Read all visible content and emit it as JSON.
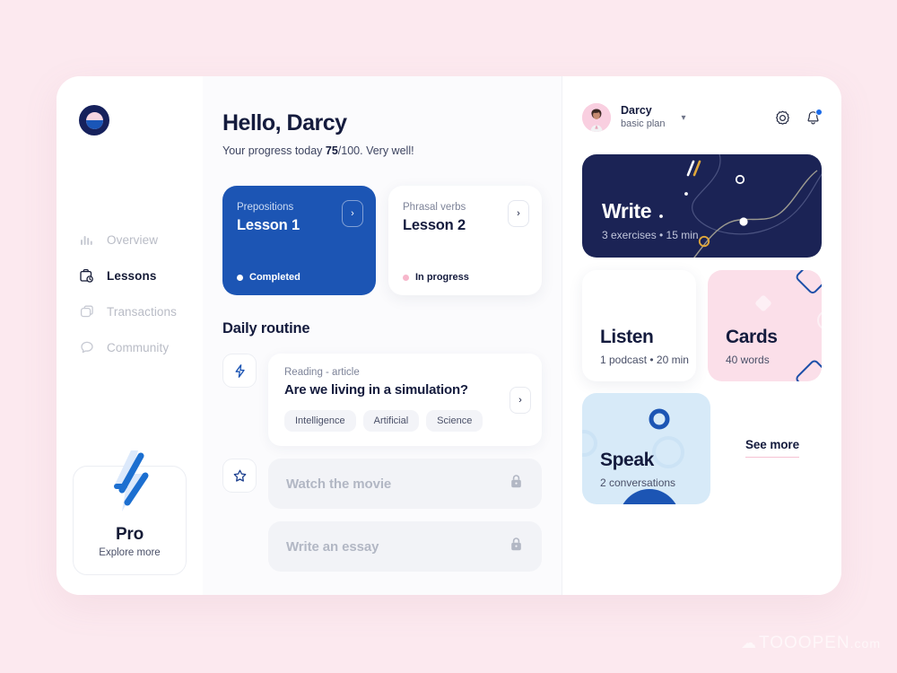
{
  "watermark": {
    "text": "TOOOPEN",
    "suffix": ".com"
  },
  "brand": {
    "logo_name": "app-logo",
    "accent_blue": "#1c55b4",
    "navy": "#141b3d",
    "pink": "#fbdfe9",
    "bg": "#fce9ef"
  },
  "sidebar": {
    "items": [
      {
        "label": "Overview",
        "icon": "bar-chart-icon",
        "active": false
      },
      {
        "label": "Lessons",
        "icon": "lesson-bag-clock-icon",
        "active": true
      },
      {
        "label": "Transactions",
        "icon": "card-stack-icon",
        "active": false
      },
      {
        "label": "Community",
        "icon": "speech-bubble-icon",
        "active": false
      }
    ],
    "pro": {
      "title": "Pro",
      "subtitle": "Explore more",
      "icon": "lightning-bolt-icon"
    }
  },
  "greeting": {
    "title": "Hello, Darcy",
    "progress_prefix": "Your progress today ",
    "progress_value": "75",
    "progress_suffix": "/100. Very well!"
  },
  "lessons": [
    {
      "category": "Prepositions",
      "title": "Lesson 1",
      "status": "Completed",
      "state": "completed"
    },
    {
      "category": "Phrasal verbs",
      "title": "Lesson 2",
      "status": "In progress",
      "state": "in-progress"
    }
  ],
  "daily_routine": {
    "section_title": "Daily routine",
    "reading": {
      "icon": "lightning-bolt-icon",
      "kicker": "Reading - article",
      "title": "Are we living in a simulation?",
      "tags": [
        "Intelligence",
        "Artificial",
        "Science"
      ]
    },
    "locked": [
      {
        "icon": "star-icon",
        "label": "Watch the movie",
        "lock": "lock-icon"
      },
      {
        "icon": "",
        "label": "Write an essay",
        "lock": "lock-icon"
      }
    ]
  },
  "profile": {
    "name": "Darcy",
    "plan": "basic plan",
    "avatar": "user-avatar",
    "chevron": "chevron-down-icon",
    "settings_icon": "gear-icon",
    "notifications_icon": "bell-icon",
    "has_notification": true
  },
  "activities": {
    "write": {
      "title": "Write",
      "meta": "3 exercises  •  15 min"
    },
    "listen": {
      "title": "Listen",
      "meta": "1 podcast  •  20 min"
    },
    "cards": {
      "title": "Cards",
      "meta": "40 words"
    },
    "speak": {
      "title": "Speak",
      "meta": "2 conversations"
    },
    "see_more": "See more"
  }
}
